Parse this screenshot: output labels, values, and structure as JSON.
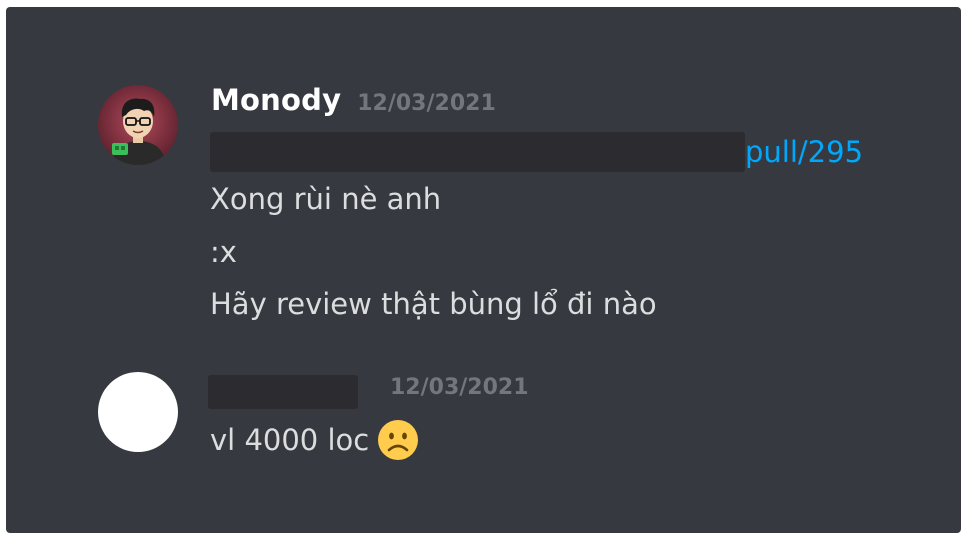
{
  "messages": [
    {
      "username": "Monody",
      "timestamp": "12/03/2021",
      "link_text": "pull/295",
      "lines": [
        "Xong rùi nè anh",
        ":x",
        "Hãy review thật bùng lổ đi nào"
      ],
      "avatar": "cartoon-boy-avatar"
    },
    {
      "username": "",
      "timestamp": "12/03/2021",
      "text": "vl 4000 loc",
      "emoji": "frowning-face-emoji",
      "avatar": "blank-white-avatar"
    }
  ],
  "colors": {
    "panel_bg": "#36393f",
    "username": "#ffffff",
    "timestamp": "#72767d",
    "text": "#dcddde",
    "link": "#00a8fc",
    "redaction": "#2b2b30"
  }
}
